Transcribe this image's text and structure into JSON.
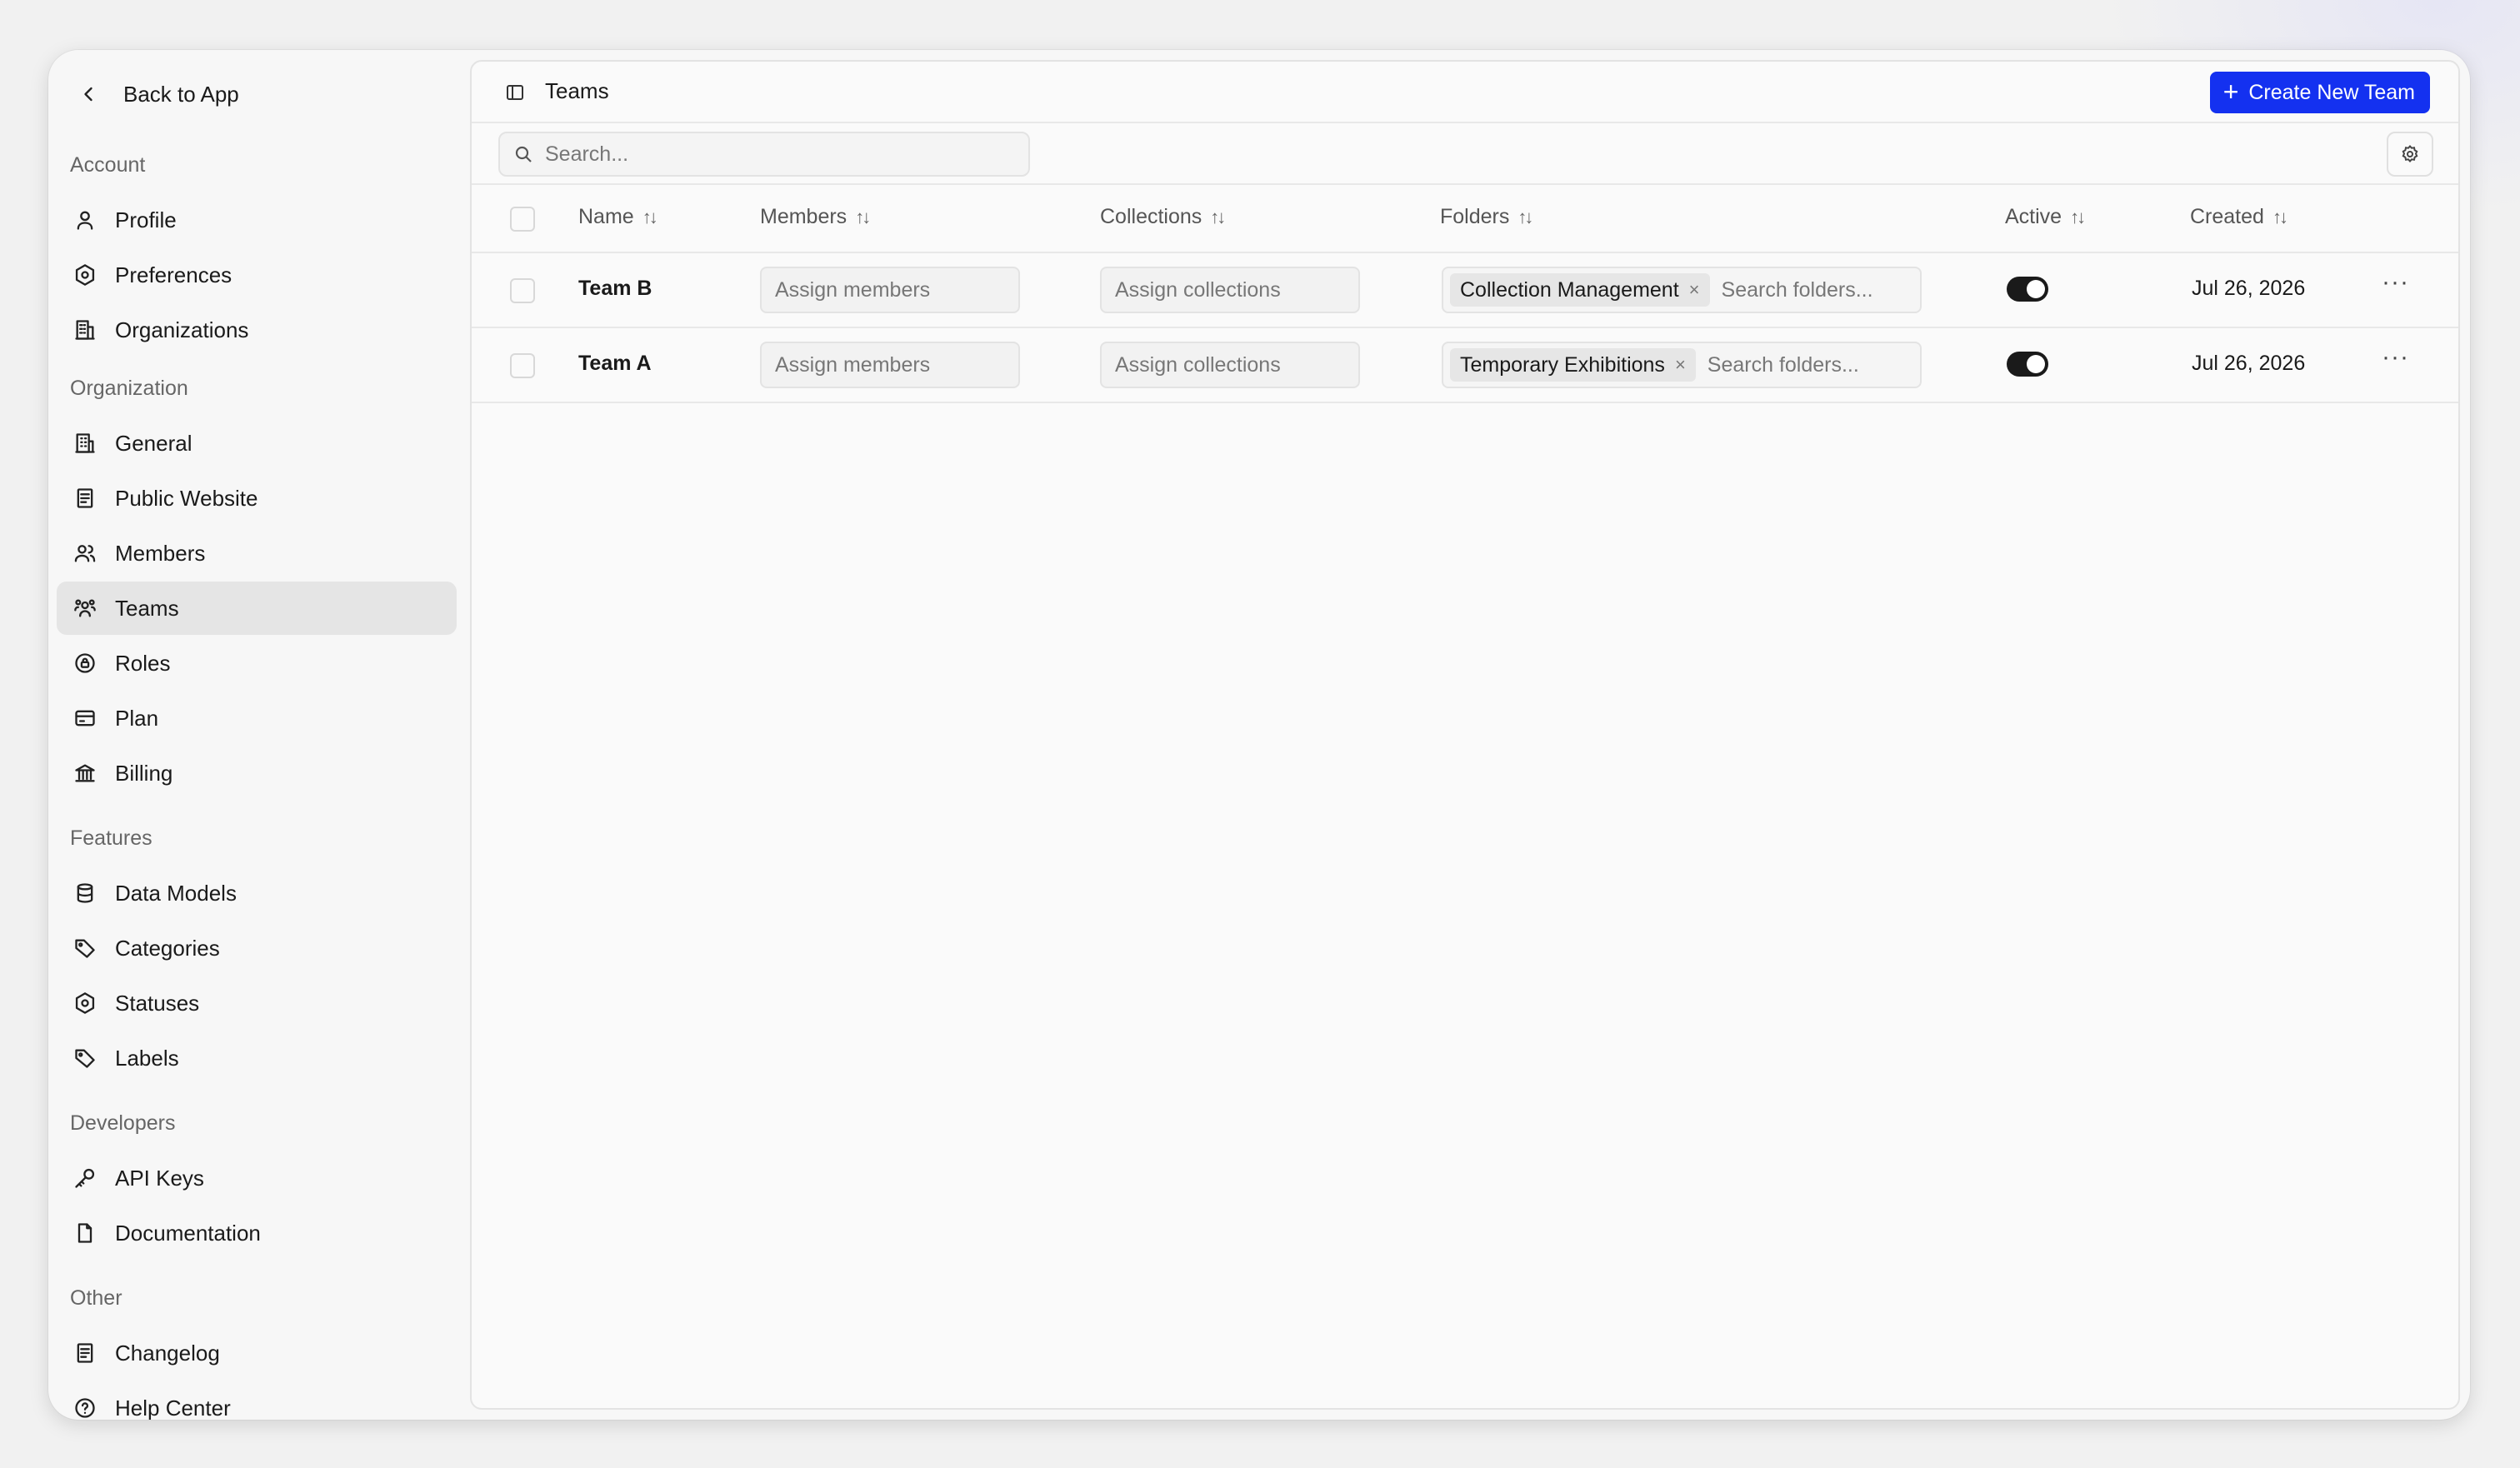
{
  "sidebar": {
    "back_label": "Back to App",
    "sections": [
      {
        "label": "Account",
        "items": [
          {
            "label": "Profile",
            "icon": "user-icon"
          },
          {
            "label": "Preferences",
            "icon": "settings-hex-icon"
          },
          {
            "label": "Organizations",
            "icon": "building-icon"
          }
        ]
      },
      {
        "label": "Organization",
        "items": [
          {
            "label": "General",
            "icon": "building-2-icon"
          },
          {
            "label": "Public Website",
            "icon": "document-icon"
          },
          {
            "label": "Members",
            "icon": "users-icon"
          },
          {
            "label": "Teams",
            "icon": "team-icon",
            "active": true
          },
          {
            "label": "Roles",
            "icon": "lock-badge-icon"
          },
          {
            "label": "Plan",
            "icon": "credit-card-icon"
          },
          {
            "label": "Billing",
            "icon": "bank-icon"
          }
        ]
      },
      {
        "label": "Features",
        "items": [
          {
            "label": "Data Models",
            "icon": "database-icon"
          },
          {
            "label": "Categories",
            "icon": "tag-icon"
          },
          {
            "label": "Statuses",
            "icon": "settings-hex-icon"
          },
          {
            "label": "Labels",
            "icon": "tag-icon"
          }
        ]
      },
      {
        "label": "Developers",
        "items": [
          {
            "label": "API Keys",
            "icon": "key-icon"
          },
          {
            "label": "Documentation",
            "icon": "file-icon"
          }
        ]
      },
      {
        "label": "Other",
        "items": [
          {
            "label": "Changelog",
            "icon": "document-icon"
          },
          {
            "label": "Help Center",
            "icon": "help-circle-icon"
          }
        ]
      }
    ]
  },
  "header": {
    "title": "Teams",
    "create_label": "Create New Team"
  },
  "search": {
    "placeholder": "Search..."
  },
  "table": {
    "columns": [
      "Name",
      "Members",
      "Collections",
      "Folders",
      "Active",
      "Created"
    ],
    "rows": [
      {
        "name": "Team B",
        "members_placeholder": "Assign members",
        "collections_placeholder": "Assign collections",
        "folder_chip": "Collection Management",
        "folders_placeholder": "Search folders...",
        "active": true,
        "created": "Jul 26, 2026"
      },
      {
        "name": "Team A",
        "members_placeholder": "Assign members",
        "collections_placeholder": "Assign collections",
        "folder_chip": "Temporary Exhibitions",
        "folders_placeholder": "Search folders...",
        "active": true,
        "created": "Jul 26, 2026"
      }
    ],
    "more_label": "···",
    "remove_label": "×",
    "sort_glyph": "↑↓"
  },
  "colors": {
    "accent": "#1431f0",
    "active_nav": "#e5e5e5",
    "toggle_on": "#1a1a1a"
  }
}
